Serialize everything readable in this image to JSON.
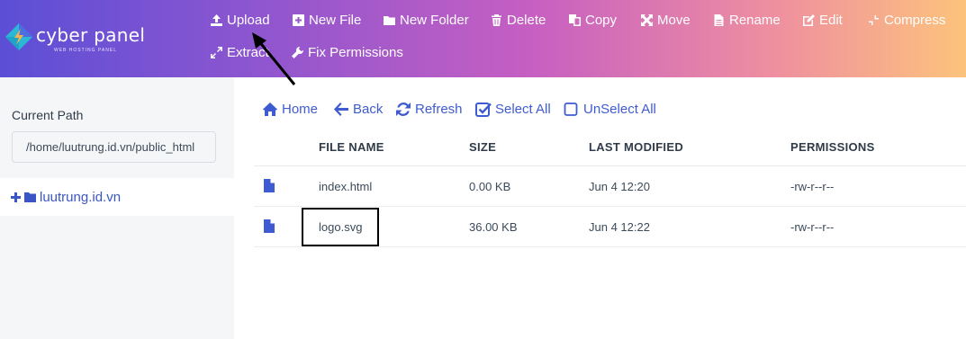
{
  "logo": {
    "name": "cyber panel",
    "tagline": "WEB HOSTING PANEL"
  },
  "toolbar": {
    "upload": "Upload",
    "new_file": "New File",
    "new_folder": "New Folder",
    "delete": "Delete",
    "copy": "Copy",
    "move": "Move",
    "rename": "Rename",
    "edit": "Edit",
    "compress": "Compress",
    "extract": "Extract",
    "fix_permissions": "Fix Permissions"
  },
  "sidebar": {
    "current_path_label": "Current Path",
    "current_path_value": "/home/luutrung.id.vn/public_html",
    "tree_root": "luutrung.id.vn"
  },
  "nav": {
    "home": "Home",
    "back": "Back",
    "refresh": "Refresh",
    "select_all": "Select All",
    "unselect_all": "UnSelect All"
  },
  "table": {
    "headers": [
      "FILE NAME",
      "SIZE",
      "LAST MODIFIED",
      "PERMISSIONS"
    ],
    "rows": [
      {
        "name": "index.html",
        "size": "0.00 KB",
        "modified": "Jun 4 12:20",
        "permissions": "-rw-r--r--"
      },
      {
        "name": "logo.svg",
        "size": "36.00 KB",
        "modified": "Jun 4 12:22",
        "permissions": "-rw-r--r--"
      }
    ]
  },
  "colors": {
    "accent": "#3f5bd1",
    "header_gradient_start": "#5b4fd6",
    "header_gradient_end": "#fcc37c"
  }
}
